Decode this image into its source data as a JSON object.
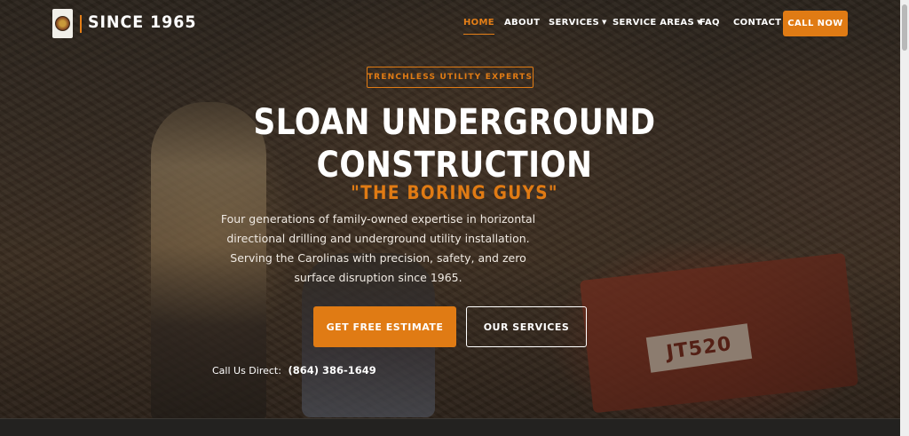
{
  "header": {
    "logo_alt": "Sloan Underground logo",
    "since_text": "SINCE 1965",
    "nav": [
      {
        "label": "HOME",
        "active": true
      },
      {
        "label": "ABOUT",
        "active": false
      },
      {
        "label": "SERVICES",
        "active": false,
        "dropdown": true
      },
      {
        "label": "SERVICE AREAS",
        "active": false,
        "dropdown": true
      },
      {
        "label": "FAQ",
        "active": false
      },
      {
        "label": "CONTACT",
        "active": false
      }
    ],
    "call_now": "CALL NOW"
  },
  "hero": {
    "badge": "TRENCHLESS UTILITY EXPERTS",
    "title_line1": "SLOAN UNDERGROUND",
    "title_line2": "CONSTRUCTION",
    "subtitle": "\"THE BORING GUYS\"",
    "description": "Four generations of family-owned expertise in horizontal directional drilling and underground utility installation. Serving the Carolinas with precision, safety, and zero surface disruption since 1965.",
    "primary_button": "GET FREE ESTIMATE",
    "secondary_button": "OUR SERVICES",
    "call_label": "Call Us Direct:",
    "phone": "(864) 386-1649",
    "machine_plate": "JT520"
  },
  "colors": {
    "accent": "#e07b14",
    "text": "#ffffff"
  }
}
